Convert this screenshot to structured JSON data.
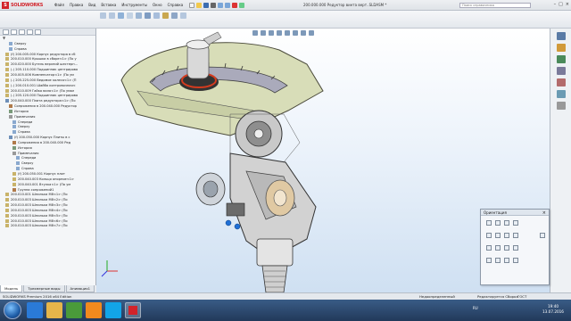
{
  "titlebar": {
    "logo_text": "SOLIDWORKS",
    "menu": [
      "Файл",
      "Правка",
      "Вид",
      "Вставка",
      "Инструменты",
      "Окно",
      "Справка"
    ],
    "document_title": "200.000.000 Редуктор винта верт..SLDASM *",
    "search_placeholder": "Поиск справочника"
  },
  "tree": {
    "filter_icon": "filter-icon",
    "items": [
      {
        "label": "Сверху",
        "indent": 2,
        "icon": "plane-icon"
      },
      {
        "label": "Справа",
        "indent": 2,
        "icon": "plane-icon"
      },
      {
        "label": "(f) 200.005.000 Корпус редуктора в сб",
        "indent": 1,
        "icon": "part-icon"
      },
      {
        "label": "200.010.000 Крышка в сборе<1> (По у",
        "indent": 1,
        "icon": "part-icon"
      },
      {
        "label": "200.020.000 Бугель верхний шестерн...",
        "indent": 1,
        "icon": "part-icon"
      },
      {
        "label": "(-) 205.110.000 Подшипник центрирова",
        "indent": 1,
        "icon": "part-icon"
      },
      {
        "label": "200.005.006 Компенсатор<1> (По ум",
        "indent": 1,
        "icon": "part-icon"
      },
      {
        "label": "(-) 205.225.000 Ведомое колесо<1> (П",
        "indent": 1,
        "icon": "part-icon"
      },
      {
        "label": "(-) 200.010.001 Шайба контровочная<",
        "indent": 1,
        "icon": "part-icon"
      },
      {
        "label": "200.010.009 Гайка вала<1> (По умол",
        "indent": 1,
        "icon": "part-icon"
      },
      {
        "label": "(-) 205.120.000 Подшипник центрирова",
        "indent": 1,
        "icon": "part-icon"
      },
      {
        "label": "200.040.000 Плита редуктора<1> (По",
        "indent": 1,
        "icon": "assembly-icon"
      },
      {
        "label": "Сопряжения в 200.040.000 Редуктор",
        "indent": 2,
        "icon": "mates-icon"
      },
      {
        "label": "История",
        "indent": 2,
        "icon": "history-icon"
      },
      {
        "label": "Примечания",
        "indent": 2,
        "icon": "notes-icon"
      },
      {
        "label": "Спереди",
        "indent": 3,
        "icon": "plane-icon"
      },
      {
        "label": "Сверху",
        "indent": 3,
        "icon": "plane-icon"
      },
      {
        "label": "Справа",
        "indent": 3,
        "icon": "plane-icon"
      },
      {
        "label": "(f) 200.050.000 Корпус Плиты в с",
        "indent": 2,
        "icon": "assembly-icon"
      },
      {
        "label": "Сопряжения в 200.040.000 Ред",
        "indent": 3,
        "icon": "mates-icon"
      },
      {
        "label": "История",
        "indent": 3,
        "icon": "history-icon"
      },
      {
        "label": "Примечания",
        "indent": 3,
        "icon": "notes-icon"
      },
      {
        "label": "Спереди",
        "indent": 4,
        "icon": "plane-icon"
      },
      {
        "label": "Сверху",
        "indent": 4,
        "icon": "plane-icon"
      },
      {
        "label": "Справа",
        "indent": 4,
        "icon": "plane-icon"
      },
      {
        "label": "(f) 200.050.001 Корпус плит",
        "indent": 3,
        "icon": "part-icon"
      },
      {
        "label": "200.040.003 Кольцо опорное<1>",
        "indent": 3,
        "icon": "part-icon"
      },
      {
        "label": "200.040.001 Втулка<1> (По ум",
        "indent": 3,
        "icon": "part-icon"
      },
      {
        "label": "Группа сопряжений1",
        "indent": 3,
        "icon": "mates-icon"
      },
      {
        "label": "200.010.001 Шпилька M8<1> (По",
        "indent": 1,
        "icon": "part-icon"
      },
      {
        "label": "200.010.003 Шпилька M8<2> (По",
        "indent": 1,
        "icon": "part-icon"
      },
      {
        "label": "200.010.003 Шпилька M8<3> (По",
        "indent": 1,
        "icon": "part-icon"
      },
      {
        "label": "200.010.003 Шпилька M8<4> (По",
        "indent": 1,
        "icon": "part-icon"
      },
      {
        "label": "200.010.003 Шпилька M8<5> (По",
        "indent": 1,
        "icon": "part-icon"
      },
      {
        "label": "200.010.003 Шпилька M8<6> (По",
        "indent": 1,
        "icon": "part-icon"
      },
      {
        "label": "200.010.003 Шпилька M8<7> (По",
        "indent": 1,
        "icon": "part-icon"
      }
    ]
  },
  "bottom_tabs": [
    "Модель",
    "Трехмерные виды",
    "Анимация1"
  ],
  "orientation": {
    "title": "Ориентация"
  },
  "status": {
    "left": "SOLIDWORKS Premium 2016 x64 Edition",
    "mid1": "Недоопределенный",
    "mid2": "Редактируется Сборка",
    "right": "ГОСТ"
  },
  "taskbar": {
    "lang": "RU",
    "time": "19:40",
    "date": "13.07.2016"
  },
  "colors": {
    "accent": "#d2232a",
    "housing": "#d8ddb8",
    "gear": "#bcbcbc",
    "dark": "#3a3a3a"
  }
}
